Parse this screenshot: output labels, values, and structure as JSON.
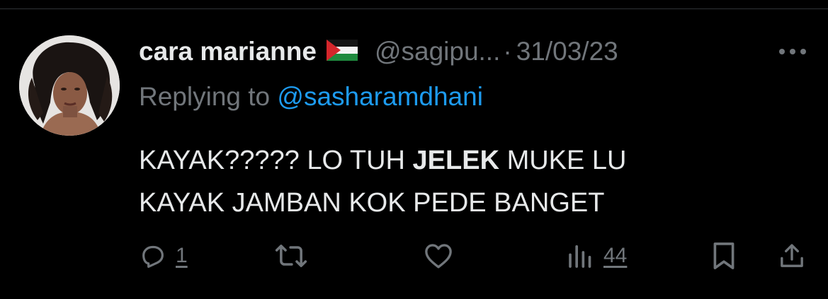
{
  "tweet": {
    "display_name": "cara marianne",
    "handle": "@sagipu...",
    "separator": "·",
    "date": "31/03/23",
    "reply_prefix": "Replying to ",
    "reply_to": "@sasharamdhani",
    "text_line1_a": "KAYAK????? LO TUH ",
    "text_line1_bold": "JELEK",
    "text_line1_b": " MUKE LU",
    "text_line2": "KAYAK JAMBAN KOK PEDE BANGET"
  },
  "actions": {
    "reply_count": "1",
    "views_count": "44"
  },
  "colors": {
    "background": "#000000",
    "text": "#e7e9ea",
    "muted": "#71767b",
    "link": "#1d9bf0",
    "divider": "#2f3336"
  },
  "icons": {
    "flag": "palestine-flag-emoji",
    "more": "more-horizontal-icon",
    "reply": "reply-icon",
    "retweet": "retweet-icon",
    "like": "heart-icon",
    "views": "views-bar-chart-icon",
    "bookmark": "bookmark-icon",
    "share": "share-icon"
  }
}
